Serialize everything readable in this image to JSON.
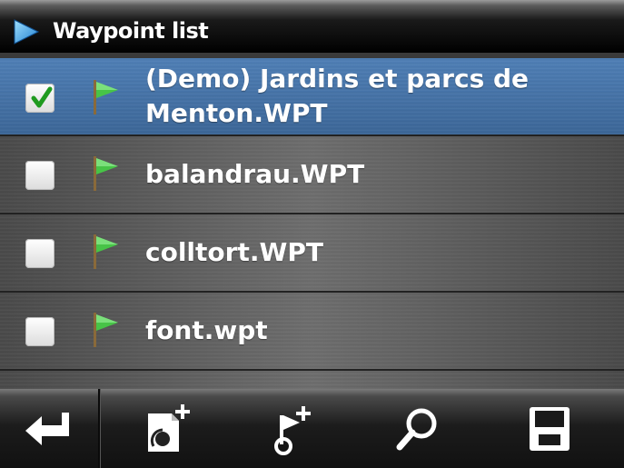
{
  "header": {
    "title": "Waypoint list",
    "icon": "play-triangle-icon"
  },
  "waypoints": [
    {
      "label_line1": "(Demo) Jardins et parcs de",
      "label_line2": "Menton.WPT",
      "checked": true,
      "selected": true
    },
    {
      "label": "balandrau.WPT",
      "checked": false,
      "selected": false
    },
    {
      "label": "colltort.WPT",
      "checked": false,
      "selected": false
    },
    {
      "label": "font.wpt",
      "checked": false,
      "selected": false
    }
  ],
  "toolbar": {
    "buttons": [
      {
        "name": "back",
        "icon": "return-arrow-icon"
      },
      {
        "name": "import-file",
        "icon": "file-add-icon"
      },
      {
        "name": "add-waypoint",
        "icon": "waypoint-add-icon"
      },
      {
        "name": "search",
        "icon": "search-icon"
      },
      {
        "name": "save",
        "icon": "save-icon"
      }
    ]
  },
  "colors": {
    "selected_row": "#4f7fb6",
    "flag_green": "#3fbf3f",
    "check_green": "#2a9a2a",
    "accent_blue": "#4aa6e0"
  }
}
